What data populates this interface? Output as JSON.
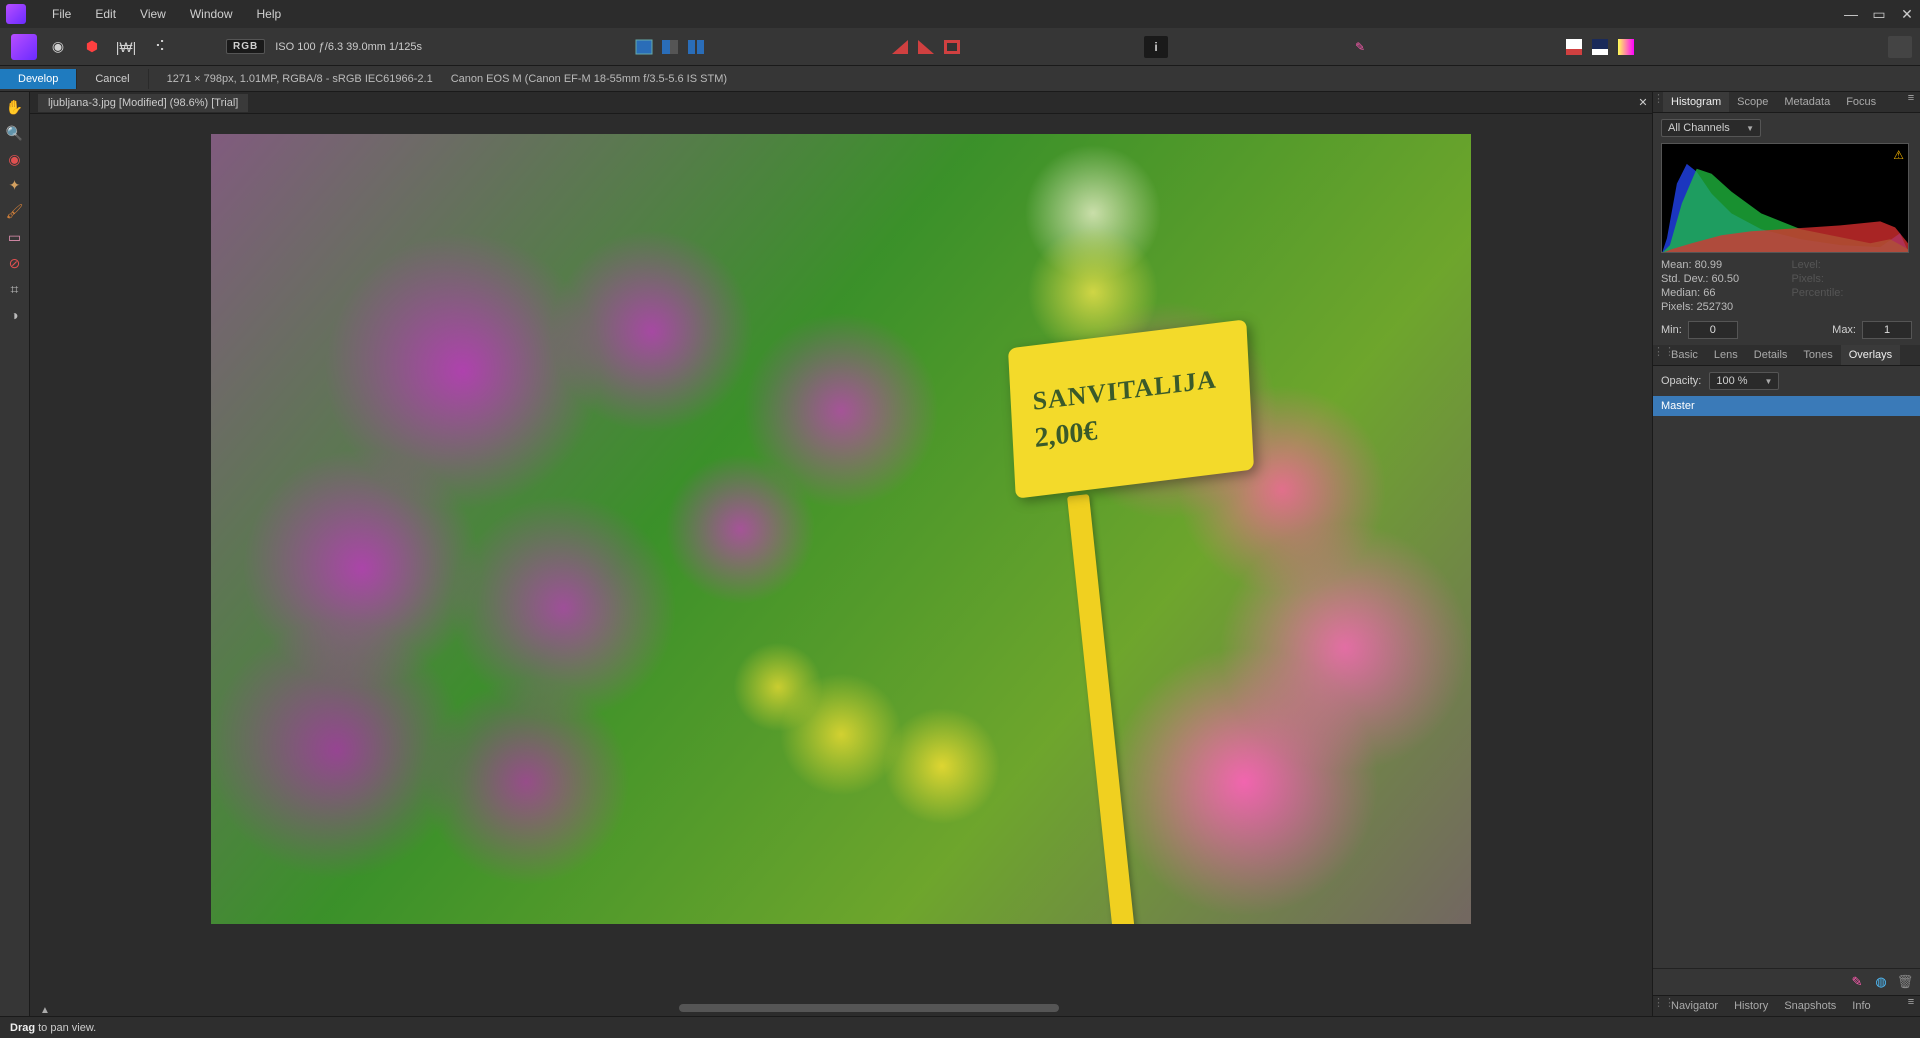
{
  "menu": {
    "file": "File",
    "edit": "Edit",
    "view": "View",
    "window": "Window",
    "help": "Help"
  },
  "toolbar": {
    "rgb_chip": "RGB",
    "camera_info": "ISO 100 ƒ/6.3 39.0mm 1/125s"
  },
  "contextbar": {
    "develop": "Develop",
    "cancel": "Cancel",
    "doc_info": "1271 × 798px, 1.01MP, RGBA/8 - sRGB IEC61966-2.1",
    "camera": "Canon EOS M (Canon EF-M 18-55mm f/3.5-5.6 IS STM)"
  },
  "tab": {
    "title": "ljubljana-3.jpg [Modified] (98.6%) [Trial]"
  },
  "sign": {
    "line1": "SANVITALIJA",
    "line2": "2,00€"
  },
  "right": {
    "tabs": {
      "histogram": "Histogram",
      "scope": "Scope",
      "metadata": "Metadata",
      "focus": "Focus"
    },
    "channel_dropdown": "All Channels",
    "stats": {
      "mean_label": "Mean:",
      "mean": "80.99",
      "stddev_label": "Std. Dev.:",
      "stddev": "60.50",
      "median_label": "Median:",
      "median": "66",
      "pixels_label": "Pixels:",
      "pixels": "252730",
      "level_label": "Level:",
      "pixels2_label": "Pixels:",
      "percentile_label": "Percentile:"
    },
    "min_label": "Min:",
    "min_value": "0",
    "max_label": "Max:",
    "max_value": "1",
    "dev_tabs": {
      "basic": "Basic",
      "lens": "Lens",
      "details": "Details",
      "tones": "Tones",
      "overlays": "Overlays"
    },
    "opacity_label": "Opacity:",
    "opacity_value": "100 %",
    "master": "Master",
    "bottom_tabs": {
      "navigator": "Navigator",
      "history": "History",
      "snapshots": "Snapshots",
      "info": "Info"
    }
  },
  "statusbar": {
    "drag": "Drag",
    "rest": " to pan view."
  }
}
